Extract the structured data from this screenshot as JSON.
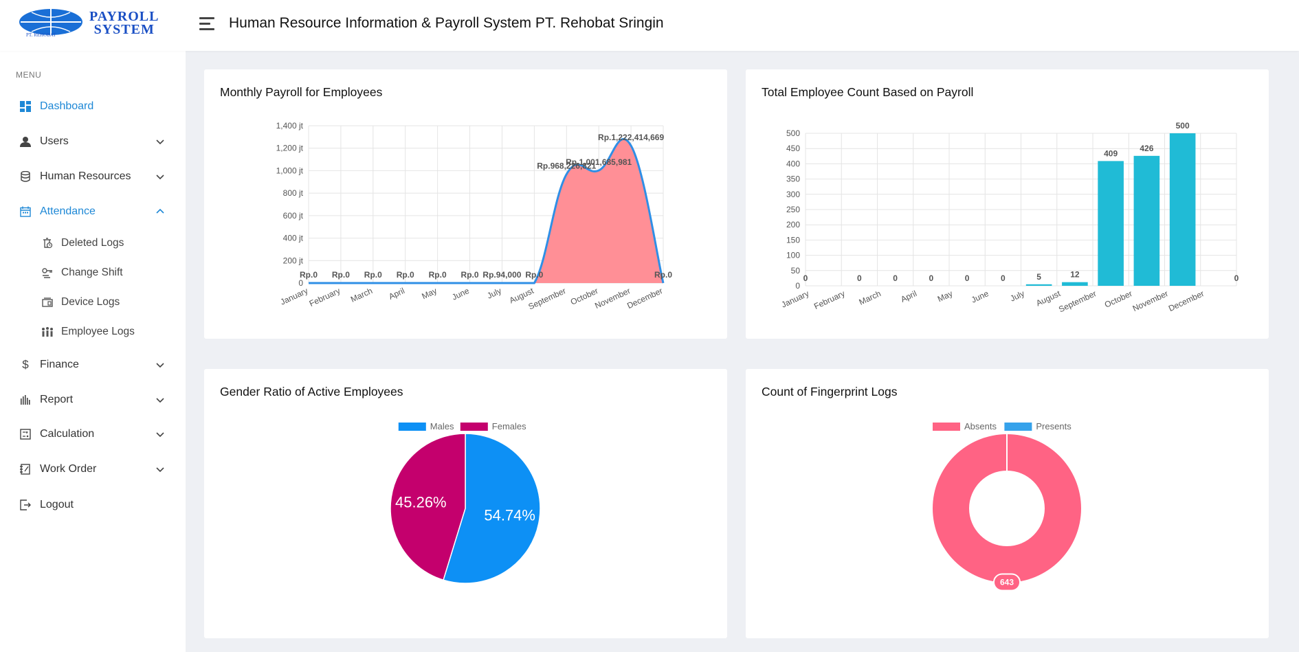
{
  "header": {
    "logo_line1": "PAYROLL",
    "logo_line2": "SYSTEM",
    "logo_sub": "PT. REHOBAT",
    "title": "Human Resource Information & Payroll System PT. Rehobat Sringin"
  },
  "sidebar": {
    "menu_label": "MENU",
    "items": [
      {
        "label": "Dashboard",
        "icon": "dashboard-icon",
        "active": true
      },
      {
        "label": "Users",
        "icon": "user-icon"
      },
      {
        "label": "Human Resources",
        "icon": "database-icon"
      },
      {
        "label": "Attendance",
        "icon": "calendar-icon",
        "active": true,
        "expanded": true
      },
      {
        "label": "Finance",
        "icon": "dollar-icon"
      },
      {
        "label": "Report",
        "icon": "bar-chart-icon"
      },
      {
        "label": "Calculation",
        "icon": "calculator-icon"
      },
      {
        "label": "Work Order",
        "icon": "notebook-icon"
      },
      {
        "label": "Logout",
        "icon": "logout-icon"
      }
    ],
    "attendance_sub": [
      {
        "label": "Deleted Logs",
        "icon": "deleted-logs-icon"
      },
      {
        "label": "Change Shift",
        "icon": "key-icon"
      },
      {
        "label": "Device Logs",
        "icon": "device-icon"
      },
      {
        "label": "Employee Logs",
        "icon": "people-icon"
      }
    ]
  },
  "colors": {
    "accent": "#1e88d6",
    "line": "#2f8fe6",
    "area": "#ff8f96",
    "bar": "#20bbd6",
    "males": "#0d90f5",
    "females": "#c4006d",
    "absents": "#ff6384",
    "presents": "#36a2eb"
  },
  "cards": {
    "payroll_title": "Monthly Payroll for Employees",
    "count_title": "Total Employee Count Based on Payroll",
    "gender_title": "Gender Ratio of Active Employees",
    "fingerprint_title": "Count of Fingerprint Logs"
  },
  "chart_data": [
    {
      "type": "area",
      "title": "Monthly Payroll for Employees",
      "categories": [
        "January",
        "February",
        "March",
        "April",
        "May",
        "June",
        "July",
        "August",
        "September",
        "October",
        "November",
        "December"
      ],
      "values": [
        0,
        0,
        0,
        0,
        0,
        0,
        94000,
        0,
        968226821,
        1001685981,
        1222414669,
        0
      ],
      "labels": [
        "Rp.0",
        "Rp.0",
        "Rp.0",
        "Rp.0",
        "Rp.0",
        "Rp.0",
        "Rp.94,000",
        "Rp.0",
        "Rp.968,226,821",
        "Rp.1,001,685,981",
        "Rp.1,222,414,669",
        "Rp.0"
      ],
      "yticks": [
        "0",
        "200 jt",
        "400 jt",
        "600 jt",
        "800 jt",
        "1,000 jt",
        "1,200 jt",
        "1,400 jt"
      ],
      "ylim": [
        0,
        1400000000
      ]
    },
    {
      "type": "bar",
      "title": "Total Employee Count Based on Payroll",
      "categories": [
        "January",
        "February",
        "March",
        "April",
        "May",
        "June",
        "July",
        "August",
        "September",
        "October",
        "November",
        "December"
      ],
      "values": [
        0,
        0,
        0,
        0,
        0,
        0,
        5,
        12,
        409,
        426,
        500,
        0
      ],
      "yticks": [
        "0",
        "50",
        "100",
        "150",
        "200",
        "250",
        "300",
        "350",
        "400",
        "450",
        "500"
      ],
      "ylim": [
        0,
        500
      ]
    },
    {
      "type": "pie",
      "title": "Gender Ratio of Active Employees",
      "series": [
        {
          "name": "Males",
          "value": 54.74,
          "label": "54.74%"
        },
        {
          "name": "Females",
          "value": 45.26,
          "label": "45.26%"
        }
      ]
    },
    {
      "type": "pie",
      "title": "Count of Fingerprint Logs",
      "series": [
        {
          "name": "Absents",
          "value": 643,
          "label": "643"
        },
        {
          "name": "Presents",
          "value": 0
        }
      ]
    }
  ]
}
